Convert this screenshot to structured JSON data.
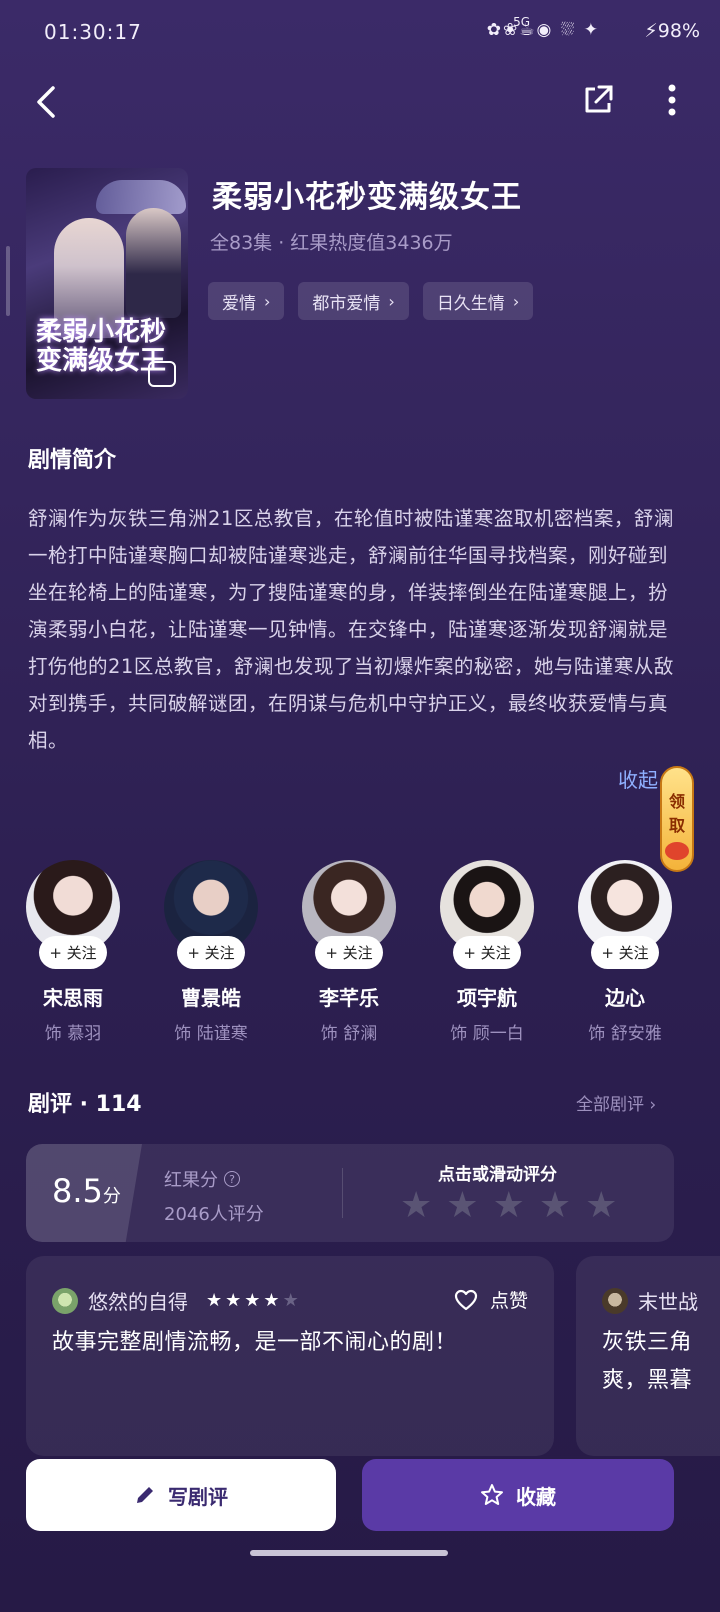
{
  "status_bar": {
    "time": "01:30:17",
    "icons": "✿❀☕◉ ⛆ ✦",
    "network": "5G",
    "battery": "98%"
  },
  "nav": {
    "back_icon": "chevron-left-icon",
    "share_icon": "share-icon",
    "more_icon": "more-vertical-icon"
  },
  "drama": {
    "poster_title": "柔弱小花秒变满级女王",
    "title": "柔弱小花秒变满级女王",
    "meta": "全83集 · 红果热度值3436万",
    "tags": [
      {
        "label": "爱情"
      },
      {
        "label": "都市爱情"
      },
      {
        "label": "日久生情"
      }
    ]
  },
  "synopsis": {
    "heading": "剧情简介",
    "text": "舒澜作为灰铁三角洲21区总教官，在轮值时被陆谨寒盗取机密档案，舒澜一枪打中陆谨寒胸口却被陆谨寒逃走，舒澜前往华国寻找档案，刚好碰到坐在轮椅上的陆谨寒，为了搜陆谨寒的身，佯装摔倒坐在陆谨寒腿上，扮演柔弱小白花，让陆谨寒一见钟情。在交锋中，陆谨寒逐渐发现舒澜就是打伤他的21区总教官，舒澜也发现了当初爆炸案的秘密，她与陆谨寒从敌对到携手，共同破解谜团，在阴谋与危机中守护正义，最终收获爱情与真相。",
    "collapse_label": "收起"
  },
  "float_badge": {
    "line1": "领",
    "line2": "取"
  },
  "cast": [
    {
      "name": "宋思雨",
      "role": "饰 慕羽",
      "follow": "+ 关注"
    },
    {
      "name": "曹景皓",
      "role": "饰 陆谨寒",
      "follow": "+ 关注"
    },
    {
      "name": "李芊乐",
      "role": "饰 舒澜",
      "follow": "+ 关注"
    },
    {
      "name": "项宇航",
      "role": "饰 顾一白",
      "follow": "+ 关注"
    },
    {
      "name": "边心",
      "role": "饰 舒安雅",
      "follow": "+ 关注"
    }
  ],
  "reviews": {
    "heading": "剧评 · 114",
    "all_label": "全部剧评 ›",
    "score": "8.5",
    "score_unit": "分",
    "score_label": "红果分",
    "score_count": "2046人评分",
    "rate_prompt": "点击或滑动评分",
    "items": [
      {
        "user": "悠然的自得",
        "stars": 4,
        "like_label": "点赞",
        "text": "故事完整剧情流畅，是一部不闹心的剧！"
      },
      {
        "user": "末世战",
        "text": "灰铁三角爽，黑暮"
      }
    ]
  },
  "actions": {
    "write_label": "写剧评",
    "fav_label": "收藏"
  }
}
